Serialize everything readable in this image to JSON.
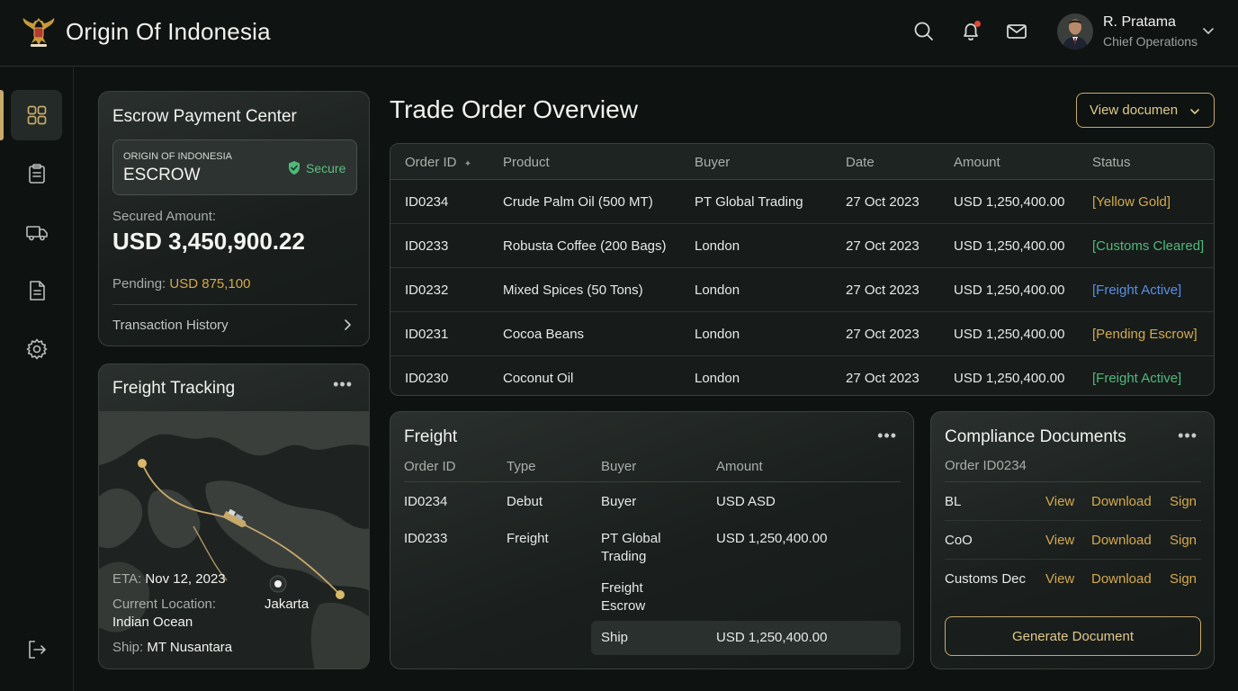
{
  "app": {
    "title": "Origin Of Indonesia"
  },
  "user": {
    "name": "R. Pratama",
    "role": "Chief Operations"
  },
  "escrow": {
    "title": "Escrow Payment Center",
    "box_small": "ORIGIN OF INDONESIA",
    "box_big": "ESCROW",
    "secure_label": "Secure",
    "secured_label": "Secured Amount:",
    "secured_amount": "USD 3,450,900.22",
    "pending_label": "Pending:",
    "pending_amount": "USD 875,100",
    "history_label": "Transaction History"
  },
  "tracking": {
    "title": "Freight Tracking",
    "eta_label": "ETA:",
    "eta_value": "Nov 12, 2023",
    "location_label": "Current Location:",
    "location_value": "Indian Ocean",
    "ship_label": "Ship:",
    "ship_value": "MT Nusantara",
    "city": "Jakarta"
  },
  "trade": {
    "title": "Trade Order Overview",
    "view_button": "View documen",
    "headers": [
      "Order ID",
      "Product",
      "Buyer",
      "Date",
      "Amount",
      "Status"
    ],
    "rows": [
      {
        "id": "ID0234",
        "product": "Crude Palm Oil (500 MT)",
        "buyer": "PT Global Trading",
        "date": "27 Oct 2023",
        "amount": "USD 1,250,400.00",
        "status": "[Yellow Gold]",
        "tone": "gold"
      },
      {
        "id": "ID0233",
        "product": "Robusta Coffee (200 Bags)",
        "buyer": "London",
        "date": "27 Oct 2023",
        "amount": "USD 1,250,400.00",
        "status": "[Customs Cleared]",
        "tone": "green"
      },
      {
        "id": "ID0232",
        "product": "Mixed Spices (50 Tons)",
        "buyer": "London",
        "date": "27 Oct 2023",
        "amount": "USD 1,250,400.00",
        "status": "[Freight Active]",
        "tone": "blue"
      },
      {
        "id": "ID0231",
        "product": "Cocoa Beans",
        "buyer": "London",
        "date": "27 Oct 2023",
        "amount": "USD 1,250,400.00",
        "status": "[Pending Escrow]",
        "tone": "gold"
      },
      {
        "id": "ID0230",
        "product": "Coconut Oil",
        "buyer": "London",
        "date": "27 Oct 2023",
        "amount": "USD 1,250,400.00",
        "status": "[Freight Active]",
        "tone": "green"
      }
    ]
  },
  "freight": {
    "title": "Freight",
    "headers": [
      "Order ID",
      "Type",
      "Buyer",
      "Amount"
    ],
    "row1": {
      "id": "ID0234",
      "type": "Debut",
      "buyer": "Buyer",
      "amount": "USD ASD"
    },
    "row2": {
      "id": "ID0233",
      "type": "Freight",
      "buyer_l1": "PT Global",
      "buyer_l2": "Trading",
      "amount": "USD 1,250,400.00"
    },
    "row3": {
      "buyer_l1": "Freight",
      "buyer_l2": "Escrow"
    },
    "row4": {
      "buyer": "Ship",
      "amount": "USD 1,250,400.00"
    }
  },
  "compliance": {
    "title": "Compliance Documents",
    "order_label": "Order ID0234",
    "docs": [
      {
        "name": "BL",
        "view": "View",
        "download": "Download",
        "sign": "Sign"
      },
      {
        "name": "CoO",
        "view": "View",
        "download": "Download",
        "sign": "Sign"
      },
      {
        "name": "Customs Dec",
        "view": "View",
        "download": "Download",
        "sign": "Sign"
      }
    ],
    "generate_label": "Generate Document"
  },
  "colors": {
    "accent_gold": "#c8a96a",
    "status_gold": "#d4a94e",
    "status_green": "#52b87c",
    "status_blue": "#5a8ee6",
    "background": "#0e1311"
  },
  "icons": {
    "header": [
      "search-icon",
      "bell-icon",
      "mail-icon",
      "chevron-down-icon"
    ],
    "sidebar": [
      "dashboard-icon",
      "clipboard-icon",
      "truck-icon",
      "document-icon",
      "gear-icon",
      "logout-icon"
    ]
  }
}
